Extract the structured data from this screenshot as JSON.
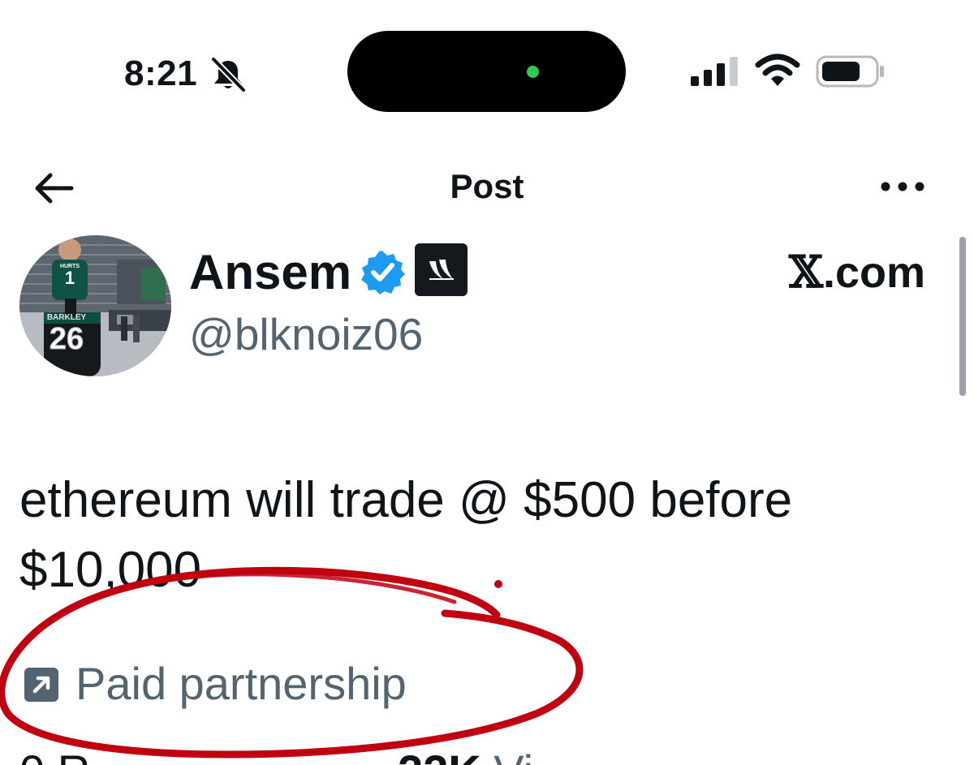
{
  "status_bar": {
    "time": "8:21",
    "silent_icon": "bell-slash-icon",
    "signal_icon": "cellular-signal-icon",
    "wifi_icon": "wifi-icon",
    "battery_icon": "battery-icon",
    "island_indicator_color": "#2ecc55"
  },
  "header": {
    "back_icon": "arrow-left-icon",
    "title": "Post",
    "more_icon": "ellipsis-icon"
  },
  "author": {
    "display_name": "Ansem",
    "handle": "@blknoiz06",
    "verified_icon": "verified-badge-icon",
    "verified_color": "#1d9bf0",
    "affiliate_badge_icon": "affiliate-logo-icon",
    "avatar_icon": "avatar-photo",
    "jersey_number": "26",
    "jersey_name": "BARKLEY",
    "child_jersey_number": "1",
    "child_jersey_name": "HURTS"
  },
  "source": {
    "x_mark": "𝕏",
    "domain_suffix": ".com"
  },
  "post": {
    "text": "ethereum will trade @ $500 before\n$10,000"
  },
  "partnership": {
    "icon": "arrow-up-right-box-icon",
    "label": "Paid partnership"
  },
  "stats": {
    "left_partial": "0 R",
    "views_count": "22K",
    "views_label": "Vi"
  },
  "annotation": {
    "color": "#c00010",
    "shape": "hand-drawn-circle"
  }
}
